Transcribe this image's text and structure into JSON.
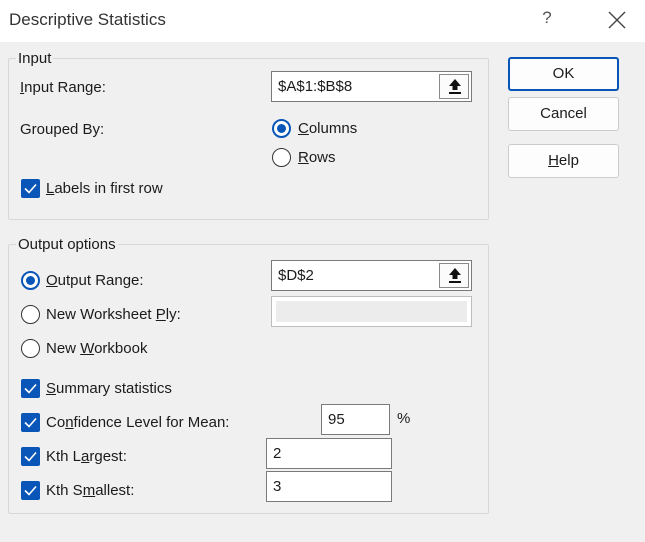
{
  "window": {
    "title": "Descriptive Statistics",
    "help_glyph": "?",
    "close_icon": "close-icon"
  },
  "input": {
    "group_title": "Input",
    "input_range": {
      "label": "Input Range:",
      "accel": "I",
      "value": "$A$1:$B$8"
    },
    "grouped_by": {
      "label": "Grouped By:",
      "options": [
        {
          "label": "Columns",
          "accel": "C",
          "checked": true
        },
        {
          "label": "Rows",
          "accel": "R",
          "checked": false
        }
      ]
    },
    "labels_first_row": {
      "label": "Labels in first row",
      "accel": "L",
      "checked": true
    }
  },
  "output": {
    "group_title": "Output options",
    "output_range": {
      "label": "Output Range:",
      "accel": "O",
      "value": "$D$2",
      "checked": true
    },
    "new_worksheet": {
      "label": "New Worksheet Ply:",
      "accel": "P",
      "value": "",
      "checked": false
    },
    "new_workbook": {
      "label": "New Workbook",
      "accel": "W",
      "checked": false
    },
    "summary_stats": {
      "label": "Summary statistics",
      "accel": "S",
      "checked": true
    },
    "confidence": {
      "label": "Confidence Level for Mean:",
      "accel": "N",
      "value": "95",
      "unit": "%",
      "checked": true
    },
    "kth_largest": {
      "label": "Kth Largest:",
      "accel": "A",
      "value": "2",
      "checked": true
    },
    "kth_smallest": {
      "label": "Kth Smallest:",
      "accel": "M",
      "value": "3",
      "checked": true
    }
  },
  "buttons": {
    "ok": "OK",
    "cancel": "Cancel",
    "help": "Help"
  },
  "colors": {
    "accent": "#0a56b8",
    "background": "#f0f0f0",
    "titlebar": "#ffffff"
  }
}
